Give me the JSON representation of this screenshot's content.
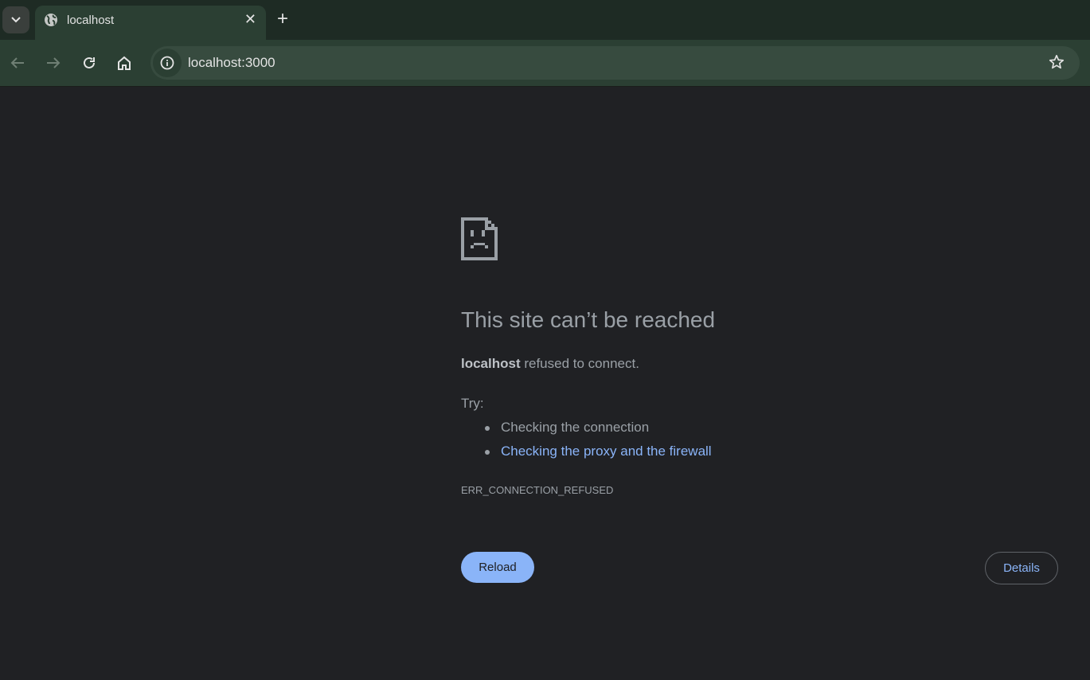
{
  "browser": {
    "tab_title": "localhost",
    "url": "localhost:3000"
  },
  "error_page": {
    "heading": "This site can’t be reached",
    "host": "localhost",
    "message": " refused to connect.",
    "try_label": "Try:",
    "suggestions": [
      "Checking the connection",
      "Checking the proxy and the firewall"
    ],
    "error_code": "ERR_CONNECTION_REFUSED",
    "reload_label": "Reload",
    "details_label": "Details"
  },
  "colors": {
    "page_bg": "#202124",
    "link": "#8ab4f8",
    "toolbar": "#2b3f33"
  }
}
